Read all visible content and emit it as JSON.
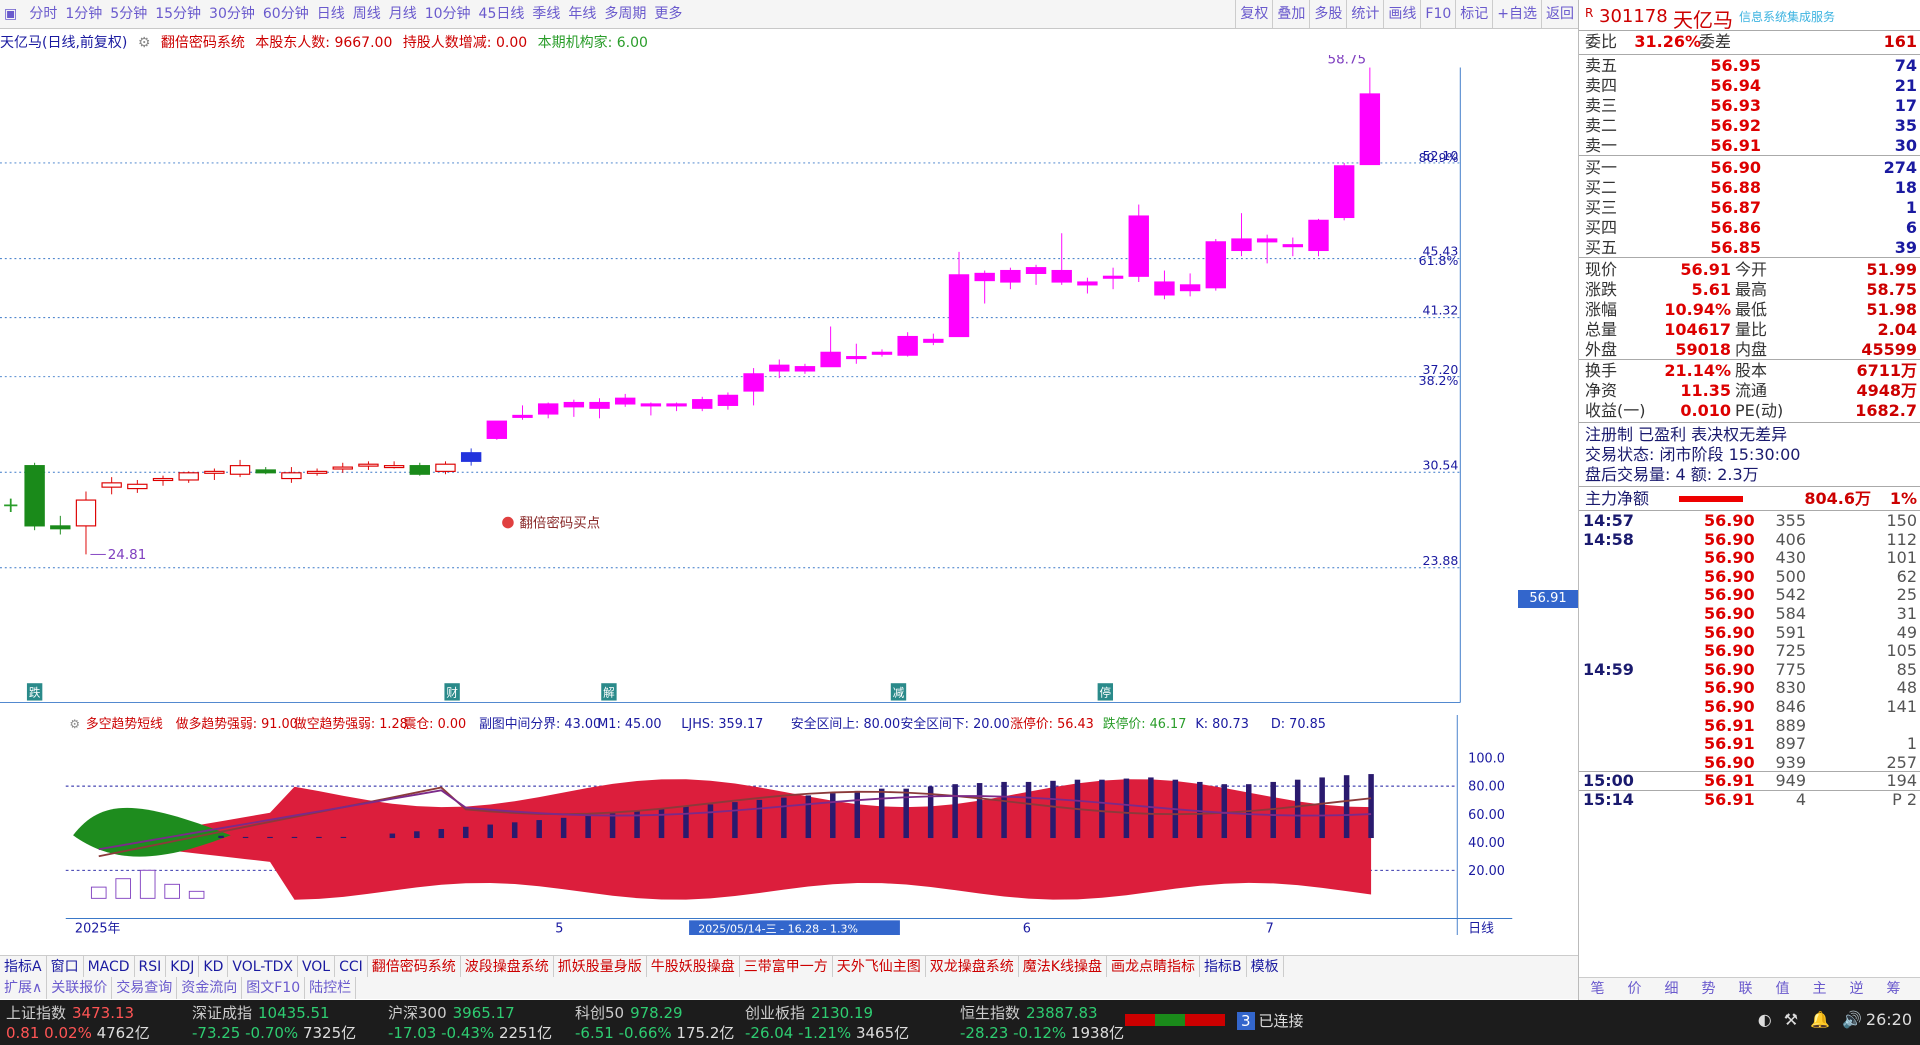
{
  "topbar": {
    "tabs": [
      "分时",
      "1分钟",
      "5分钟",
      "15分钟",
      "30分钟",
      "60分钟",
      "日线",
      "周线",
      "月线",
      "10分钟",
      "45日线",
      "季线",
      "年线",
      "多周期",
      "更多"
    ],
    "right": [
      "复权",
      "叠加",
      "多股",
      "统计",
      "画线",
      "F10",
      "标记",
      "+自选",
      "返回"
    ]
  },
  "infoline": {
    "name": "天亿马(日线,前复权)",
    "system": "翻倍密码系统",
    "holders": "本股东人数: 9667.00",
    "holders_change": "持股人数增减: 0.00",
    "institutions": "本期机构家: 6.00"
  },
  "chart": {
    "price_labels": [
      "52.10",
      "45.43",
      "41.32",
      "37.20",
      "30.54",
      "23.88"
    ],
    "pct_labels": [
      "80.9%",
      "61.8%",
      "38.2%"
    ],
    "current_tag": "56.91",
    "high_label": "58.75",
    "low_label": "24.81",
    "buy_signal": "翻倍密码买点",
    "date_markers": [
      "跌",
      "财",
      "解",
      "减",
      "停"
    ]
  },
  "chart_data": {
    "type": "candlestick",
    "title": "天亿马(日线,前复权)",
    "ohlc": [
      [
        31.0,
        31.2,
        26.5,
        26.8
      ],
      [
        26.8,
        27.5,
        26.2,
        26.6
      ],
      [
        26.8,
        29.2,
        24.81,
        28.6
      ],
      [
        29.5,
        30.2,
        29.0,
        29.8
      ],
      [
        29.4,
        30.0,
        29.1,
        29.7
      ],
      [
        30.0,
        30.3,
        29.6,
        30.1
      ],
      [
        30.0,
        30.6,
        29.8,
        30.5
      ],
      [
        30.5,
        30.8,
        30.0,
        30.6
      ],
      [
        30.4,
        31.4,
        30.2,
        31.0
      ],
      [
        30.7,
        30.9,
        30.4,
        30.5
      ],
      [
        30.1,
        30.9,
        29.8,
        30.5
      ],
      [
        30.6,
        30.8,
        30.3,
        30.6
      ],
      [
        30.8,
        31.2,
        30.5,
        30.9
      ],
      [
        31.0,
        31.3,
        30.7,
        31.1
      ],
      [
        31.0,
        31.3,
        30.8,
        31.0
      ],
      [
        31.0,
        31.2,
        30.3,
        30.4
      ],
      [
        30.6,
        31.3,
        30.4,
        31.1
      ],
      [
        31.3,
        32.2,
        31.0,
        31.9
      ],
      [
        32.9,
        34.1,
        32.8,
        34.1
      ],
      [
        34.4,
        35.2,
        34.2,
        34.5
      ],
      [
        34.6,
        35.4,
        34.3,
        35.3
      ],
      [
        35.1,
        35.6,
        34.4,
        35.4
      ],
      [
        35.0,
        35.7,
        34.3,
        35.4
      ],
      [
        35.3,
        36.0,
        35.1,
        35.7
      ],
      [
        35.2,
        35.4,
        34.5,
        35.3
      ],
      [
        35.2,
        35.4,
        34.8,
        35.3
      ],
      [
        35.0,
        35.8,
        34.8,
        35.6
      ],
      [
        35.2,
        36.1,
        34.9,
        35.9
      ],
      [
        36.2,
        37.8,
        35.2,
        37.4
      ],
      [
        37.6,
        38.4,
        37.1,
        38.0
      ],
      [
        37.6,
        38.1,
        37.4,
        37.9
      ],
      [
        37.9,
        40.7,
        37.9,
        38.9
      ],
      [
        38.5,
        39.5,
        38.1,
        38.6
      ],
      [
        38.8,
        39.1,
        38.6,
        38.9
      ],
      [
        38.7,
        40.3,
        38.6,
        40.0
      ],
      [
        39.6,
        40.2,
        39.4,
        39.8
      ],
      [
        40.0,
        45.9,
        40.0,
        44.3
      ],
      [
        43.9,
        44.6,
        42.3,
        44.4
      ],
      [
        43.8,
        44.8,
        43.3,
        44.6
      ],
      [
        44.4,
        45.0,
        43.6,
        44.8
      ],
      [
        44.6,
        47.2,
        43.6,
        43.8
      ],
      [
        43.6,
        44.1,
        43.0,
        43.8
      ],
      [
        44.2,
        44.8,
        43.3,
        44.1
      ],
      [
        44.2,
        49.2,
        43.8,
        48.4
      ],
      [
        42.9,
        44.6,
        42.6,
        43.8
      ],
      [
        43.2,
        44.4,
        42.8,
        43.6
      ],
      [
        43.4,
        46.8,
        43.2,
        46.6
      ],
      [
        46.8,
        48.6,
        45.6,
        46.0
      ],
      [
        46.8,
        47.1,
        45.1,
        46.6
      ],
      [
        46.3,
        46.9,
        45.6,
        46.4
      ],
      [
        46.0,
        48.2,
        45.6,
        48.1
      ],
      [
        48.3,
        52.1,
        48.1,
        51.9
      ],
      [
        51.99,
        58.75,
        51.98,
        56.91
      ]
    ],
    "ylim": [
      23.88,
      58.75
    ],
    "indicator": {
      "name": "多空趋势短线",
      "labels": [
        "做多趋势强弱: 91.00",
        "做空趋势强弱: 1.28",
        "震仓: 0.00",
        "副图中间分界: 43.00",
        "M1: 45.00",
        "LJHS: 359.17",
        "安全区间上: 80.00",
        "安全区间下: 20.00",
        "涨停价: 56.43",
        "跌停价: 46.17",
        "K: 80.73",
        "D: 70.85"
      ],
      "y_ticks": [
        "100.0",
        "80.00",
        "60.00",
        "40.00",
        "20.00"
      ],
      "bars": [
        8,
        14,
        20,
        10,
        5,
        2,
        1,
        1,
        1,
        1,
        1,
        0,
        4,
        6,
        8,
        10,
        12,
        14,
        16,
        18,
        20,
        22,
        24,
        26,
        28,
        30,
        32,
        34,
        36,
        38,
        40,
        42,
        44,
        44,
        46,
        48,
        49,
        50,
        50,
        51,
        52,
        52,
        53,
        54,
        52,
        50,
        48,
        48,
        50,
        52,
        54,
        56,
        57
      ],
      "x_labels": [
        "2025年",
        "5",
        "2025/05/14-三 - 16.28 - 1.3%",
        "6",
        "7",
        "日线"
      ]
    }
  },
  "rpanel": {
    "code": "301178",
    "name": "天亿马",
    "sub": "信息系统集成服务",
    "weibi_label": "委比",
    "weibi": "31.26%",
    "weicha_label": "委差",
    "weicha": "161",
    "sell": [
      [
        "卖五",
        "56.95",
        "74"
      ],
      [
        "卖四",
        "56.94",
        "21"
      ],
      [
        "卖三",
        "56.93",
        "17"
      ],
      [
        "卖二",
        "56.92",
        "35"
      ],
      [
        "卖一",
        "56.91",
        "30"
      ]
    ],
    "buy": [
      [
        "买一",
        "56.90",
        "274"
      ],
      [
        "买二",
        "56.88",
        "18"
      ],
      [
        "买三",
        "56.87",
        "1"
      ],
      [
        "买四",
        "56.86",
        "6"
      ],
      [
        "买五",
        "56.85",
        "39"
      ]
    ],
    "stats": [
      [
        "现价",
        "56.91",
        "今开",
        "51.99"
      ],
      [
        "涨跌",
        "5.61",
        "最高",
        "58.75"
      ],
      [
        "涨幅",
        "10.94%",
        "最低",
        "51.98"
      ],
      [
        "总量",
        "104617",
        "量比",
        "2.04"
      ],
      [
        "外盘",
        "59018",
        "内盘",
        "45599"
      ],
      [
        "换手",
        "21.14%",
        "股本",
        "6711万"
      ],
      [
        "净资",
        "11.35",
        "流通",
        "4948万"
      ],
      [
        "收益(一)",
        "0.010",
        "PE(动)",
        "1682.7"
      ]
    ],
    "reg": "注册制 已盈利 表决权无差异",
    "trade_state": "交易状态: 闭市阶段 15:30:00",
    "after_trade": "盘后交易量: 4  额: 2.3万",
    "main_flow_label": "主力净额",
    "main_flow": "804.6万",
    "main_flow_pct": "1%",
    "ticks": [
      [
        "14:57",
        "56.90",
        "355",
        "150"
      ],
      [
        "14:58",
        "56.90",
        "406",
        "112"
      ],
      [
        "",
        "56.90",
        "430",
        "101"
      ],
      [
        "",
        "56.90",
        "500",
        "62"
      ],
      [
        "",
        "56.90",
        "542",
        "25"
      ],
      [
        "",
        "56.90",
        "584",
        "31"
      ],
      [
        "",
        "56.90",
        "591",
        "49"
      ],
      [
        "",
        "56.90",
        "725",
        "105"
      ],
      [
        "14:59",
        "56.90",
        "775",
        "85"
      ],
      [
        "",
        "56.90",
        "830",
        "48"
      ],
      [
        "",
        "56.90",
        "846",
        "141"
      ],
      [
        "",
        "56.91",
        "889",
        ""
      ],
      [
        "",
        "56.91",
        "897",
        "1"
      ],
      [
        "",
        "56.90",
        "939",
        "257"
      ],
      [
        "15:00",
        "56.91",
        "949",
        "194"
      ],
      [
        "15:14",
        "56.91",
        "4",
        "P 2"
      ]
    ]
  },
  "indtabs": [
    "指标A",
    "窗口",
    "MACD",
    "RSI",
    "KDJ",
    "KD",
    "VOL-TDX",
    "VOL",
    "CCI",
    "翻倍密码系统",
    "波段操盘系统",
    "抓妖股量身版",
    "牛股妖股操盘",
    "三带富甲一方",
    "天外飞仙主图",
    "双龙操盘系统",
    "魔法K线操盘",
    "画龙点睛指标",
    "指标B",
    "模板"
  ],
  "bottomtabs": [
    "扩展∧",
    "关联报价",
    "交易查询",
    "资金流向",
    "图文F10",
    "陆控栏"
  ],
  "rtabs": [
    "笔",
    "价",
    "细",
    "势",
    "联",
    "值",
    "主",
    "逆",
    "筹"
  ],
  "statusbar": [
    {
      "name": "上证指数",
      "value": "3473.13",
      "change": "0.81",
      "pct": "0.02%",
      "amount": "4762亿"
    },
    {
      "name": "深证成指",
      "value": "10435.51",
      "change": "-73.25",
      "pct": "-0.70%",
      "amount": "7325亿"
    },
    {
      "name": "沪深300",
      "value": "3965.17",
      "change": "-17.03",
      "pct": "-0.43%",
      "amount": "2251亿"
    },
    {
      "name": "科创50",
      "value": "978.29",
      "change": "-6.51",
      "pct": "-0.66%",
      "amount": "175.2亿"
    },
    {
      "name": "创业板指",
      "value": "2130.19",
      "change": "-26.04",
      "pct": "-1.21%",
      "amount": "3465亿"
    },
    {
      "name": "恒生指数",
      "value": "23887.83",
      "change": "-28.23",
      "pct": "-0.12%",
      "amount": "1938亿"
    }
  ],
  "status_right": {
    "conn_count": "3",
    "conn_text": "已连接",
    "time": "26:20"
  }
}
